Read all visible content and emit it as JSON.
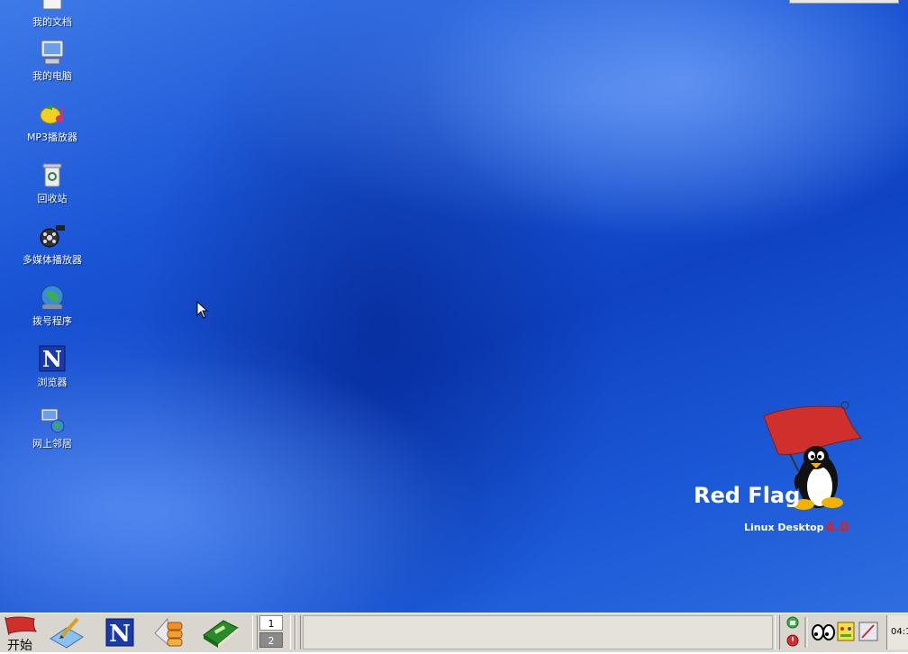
{
  "desktop": {
    "icons": [
      {
        "label": "我的文档",
        "icon": "my-documents-icon"
      },
      {
        "label": "我的电脑",
        "icon": "my-computer-icon"
      },
      {
        "label": "MP3播放器",
        "icon": "mp3-player-icon"
      },
      {
        "label": "回收站",
        "icon": "recycle-bin-icon"
      },
      {
        "label": "多媒体播放器",
        "icon": "multimedia-player-icon"
      },
      {
        "label": "拨号程序",
        "icon": "dialer-icon"
      },
      {
        "label": "浏览器",
        "icon": "browser-icon"
      },
      {
        "label": "网上邻居",
        "icon": "network-neighborhood-icon"
      }
    ],
    "logo": {
      "brand": "Red Flag",
      "product": "Linux Desktop",
      "version": "4.0"
    }
  },
  "taskbar": {
    "start_label": "开始",
    "quick_launch": [
      "editor-icon",
      "browser-icon",
      "package-manager-icon",
      "dictionary-icon"
    ],
    "pager": {
      "desk1": "1",
      "desk2": "2"
    },
    "clock": "04:1"
  },
  "colors": {
    "desktop_blue": "#1a55d6",
    "taskbar": "#d8d6ce",
    "flag_red": "#d0302c",
    "version_red": "#e02020"
  }
}
